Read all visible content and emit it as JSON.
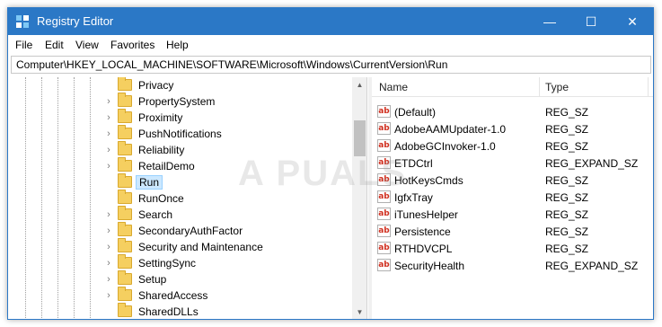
{
  "window": {
    "title": "Registry Editor"
  },
  "controls": {
    "minimize": "—",
    "maximize": "☐",
    "close": "✕"
  },
  "menu": [
    "File",
    "Edit",
    "View",
    "Favorites",
    "Help"
  ],
  "address": "Computer\\HKEY_LOCAL_MACHINE\\SOFTWARE\\Microsoft\\Windows\\CurrentVersion\\Run",
  "tree": {
    "items": [
      {
        "label": "Privacy",
        "expandable": false
      },
      {
        "label": "PropertySystem",
        "expandable": true
      },
      {
        "label": "Proximity",
        "expandable": true
      },
      {
        "label": "PushNotifications",
        "expandable": true
      },
      {
        "label": "Reliability",
        "expandable": true
      },
      {
        "label": "RetailDemo",
        "expandable": true
      },
      {
        "label": "Run",
        "expandable": false,
        "selected": true
      },
      {
        "label": "RunOnce",
        "expandable": false
      },
      {
        "label": "Search",
        "expandable": true
      },
      {
        "label": "SecondaryAuthFactor",
        "expandable": true
      },
      {
        "label": "Security and Maintenance",
        "expandable": true
      },
      {
        "label": "SettingSync",
        "expandable": true
      },
      {
        "label": "Setup",
        "expandable": true
      },
      {
        "label": "SharedAccess",
        "expandable": true
      },
      {
        "label": "SharedDLLs",
        "expandable": false
      }
    ]
  },
  "list": {
    "columns": [
      "Name",
      "Type"
    ],
    "rows": [
      {
        "name": "(Default)",
        "type": "REG_SZ"
      },
      {
        "name": "AdobeAAMUpdater-1.0",
        "type": "REG_SZ"
      },
      {
        "name": "AdobeGCInvoker-1.0",
        "type": "REG_SZ"
      },
      {
        "name": "ETDCtrl",
        "type": "REG_EXPAND_SZ"
      },
      {
        "name": "HotKeysCmds",
        "type": "REG_SZ"
      },
      {
        "name": "IgfxTray",
        "type": "REG_SZ"
      },
      {
        "name": "iTunesHelper",
        "type": "REG_SZ"
      },
      {
        "name": "Persistence",
        "type": "REG_SZ"
      },
      {
        "name": "RTHDVCPL",
        "type": "REG_SZ"
      },
      {
        "name": "SecurityHealth",
        "type": "REG_EXPAND_SZ"
      }
    ]
  },
  "value_icon_text": "ab",
  "watermark": "A PUALS",
  "colors": {
    "titlebar": "#2b78c6",
    "selection": "#cce8ff",
    "folder": "#f5cf60",
    "value_icon": "#d03020"
  }
}
